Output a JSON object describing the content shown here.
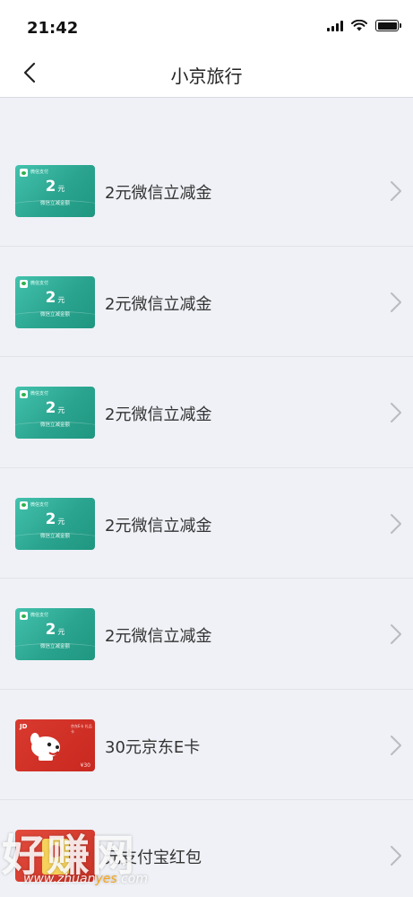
{
  "status_bar": {
    "time": "21:42"
  },
  "header": {
    "title": "小京旅行"
  },
  "wechat_card": {
    "brand": "微信支付",
    "amount": "2",
    "unit": "元",
    "subtitle": "微信立减金额"
  },
  "jd_card": {
    "logo": "JD",
    "caption": "京东E卡 礼品卡",
    "value": "¥30"
  },
  "items": [
    {
      "label": "2元微信立减金",
      "card": "wechat"
    },
    {
      "label": "2元微信立减金",
      "card": "wechat"
    },
    {
      "label": "2元微信立减金",
      "card": "wechat"
    },
    {
      "label": "2元微信立减金",
      "card": "wechat"
    },
    {
      "label": "2元微信立减金",
      "card": "wechat"
    },
    {
      "label": "30元京东E卡",
      "card": "jd"
    },
    {
      "label": "元支付宝红包",
      "card": "alipay"
    }
  ],
  "watermark": {
    "text": "好赚网",
    "url_prefix": "www.zhuan",
    "url_highlight": "yes",
    "url_suffix": ".com"
  },
  "colors": {
    "wechat_card": "#2aa48f",
    "jd_card": "#c8281f",
    "background": "#eff1f6"
  }
}
